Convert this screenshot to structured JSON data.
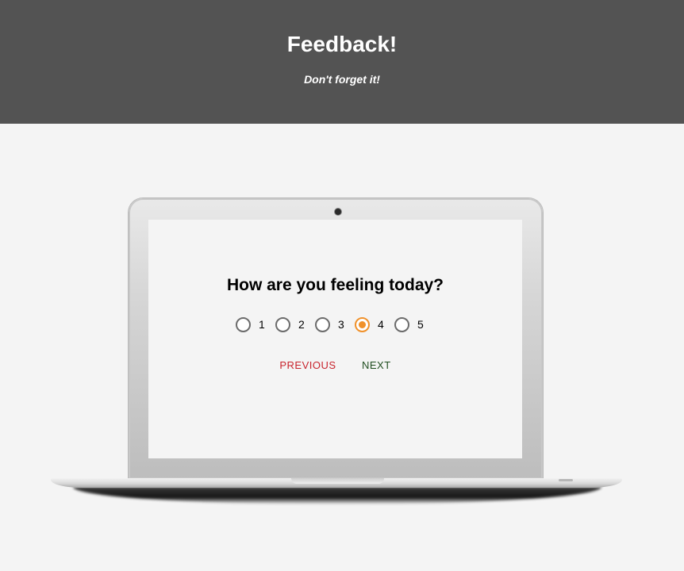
{
  "header": {
    "title": "Feedback!",
    "subtitle": "Don't forget it!",
    "background_color": "#535353"
  },
  "survey": {
    "question": "How are you feeling today?",
    "options": [
      {
        "label": "1",
        "selected": false
      },
      {
        "label": "2",
        "selected": false
      },
      {
        "label": "3",
        "selected": false
      },
      {
        "label": "4",
        "selected": true
      },
      {
        "label": "5",
        "selected": false
      }
    ],
    "selected_color": "#f0912a",
    "previous_label": "PREVIOUS",
    "previous_color": "#c8232c",
    "next_label": "NEXT",
    "next_color": "#1f4d1f"
  }
}
